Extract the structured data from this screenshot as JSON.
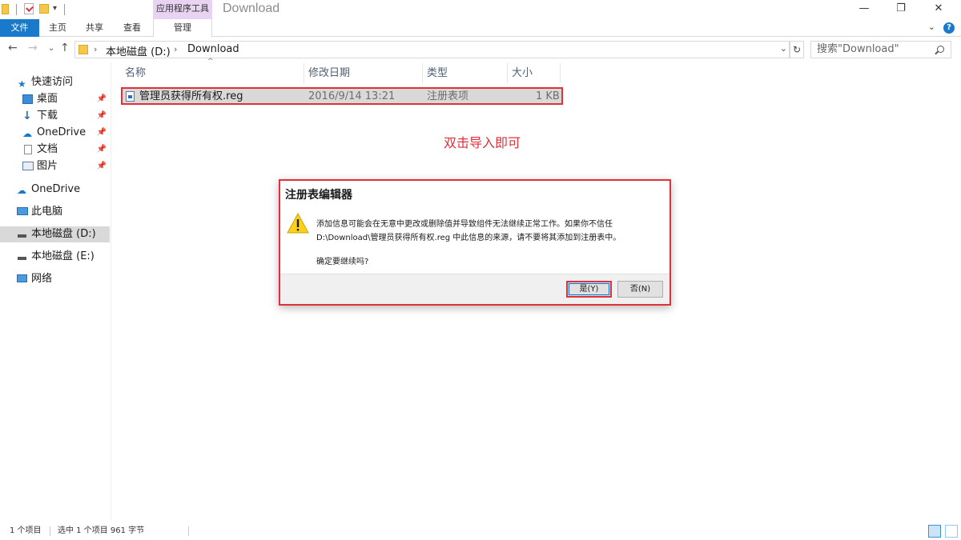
{
  "window": {
    "title": "Download",
    "context_tab_group": "应用程序工具",
    "controls": {
      "minimize": "—",
      "maximize": "❐",
      "close": "✕"
    }
  },
  "ribbon": {
    "tabs": [
      "文件",
      "主页",
      "共享",
      "查看",
      "管理"
    ]
  },
  "address": {
    "path": [
      "本地磁盘 (D:)",
      "Download"
    ],
    "search_placeholder": "搜索\"Download\""
  },
  "sidebar": {
    "items": [
      {
        "label": "快速访问",
        "icon": "star-icon",
        "pinned": false
      },
      {
        "label": "桌面",
        "icon": "desktop-icon",
        "pinned": true
      },
      {
        "label": "下载",
        "icon": "download-arrow-icon",
        "pinned": true
      },
      {
        "label": "OneDrive",
        "icon": "cloud-icon",
        "pinned": true
      },
      {
        "label": "文档",
        "icon": "document-icon",
        "pinned": true
      },
      {
        "label": "图片",
        "icon": "picture-icon",
        "pinned": true
      },
      {
        "label": "OneDrive",
        "icon": "cloud-icon",
        "pinned": false
      },
      {
        "label": "此电脑",
        "icon": "computer-icon",
        "pinned": false
      },
      {
        "label": "本地磁盘 (D:)",
        "icon": "drive-icon",
        "pinned": false,
        "selected": true
      },
      {
        "label": "本地磁盘 (E:)",
        "icon": "drive-icon",
        "pinned": false
      },
      {
        "label": "网络",
        "icon": "network-icon",
        "pinned": false
      }
    ]
  },
  "file_list": {
    "columns": [
      "名称",
      "修改日期",
      "类型",
      "大小"
    ],
    "rows": [
      {
        "name": "管理员获得所有权.reg",
        "modified": "2016/9/14 13:21",
        "type": "注册表项",
        "size": "1 KB"
      }
    ]
  },
  "annotation": {
    "text": "双击导入即可",
    "color": "#e0303a"
  },
  "dialog": {
    "title": "注册表编辑器",
    "line1": "添加信息可能会在无意中更改或删除值并导致组件无法继续正常工作。如果你不信任",
    "line2": "D:\\Download\\管理员获得所有权.reg 中此信息的来源，请不要将其添加到注册表中。",
    "question": "确定要继续吗?",
    "yes_label": "是(Y)",
    "no_label": "否(N)"
  },
  "status": {
    "item_count": "1 个项目",
    "selection": "选中 1 个项目  961 字节"
  },
  "colors": {
    "accent": "#1979ca",
    "highlight": "#e0303a",
    "context_tab": "#e8d3f2"
  }
}
